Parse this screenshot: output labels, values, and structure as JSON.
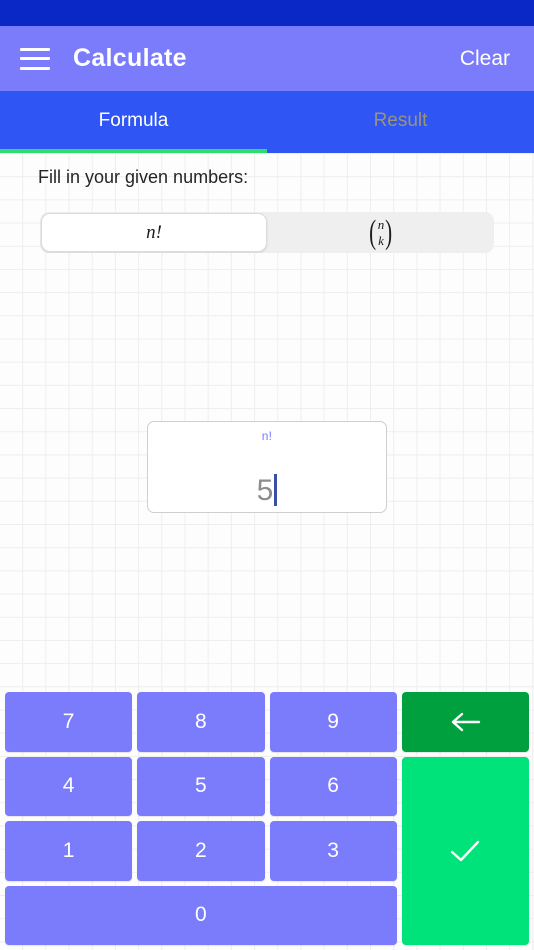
{
  "status_bar": {
    "color": "#0a28c6"
  },
  "app_bar": {
    "menu_icon": "hamburger-menu-icon",
    "title": "Calculate",
    "action_label": "Clear",
    "background": "#7b7cfb"
  },
  "tabs": {
    "background": "#2f55f4",
    "indicator_color": "#2ede6c",
    "active_index": 0,
    "items": [
      {
        "label": "Formula",
        "active": true
      },
      {
        "label": "Result",
        "active": false
      }
    ]
  },
  "main": {
    "prompt": "Fill in your given numbers:",
    "formula_selector": {
      "options": [
        {
          "id": "factorial",
          "label": "n!",
          "selected": true
        },
        {
          "id": "binomial",
          "top": "n",
          "bottom": "k",
          "selected": false
        }
      ]
    },
    "input_card": {
      "label": "n!",
      "value": "5",
      "caret_visible": true,
      "label_color": "#7b7cfb",
      "value_color": "#8d8d8d"
    }
  },
  "keypad": {
    "key_color": "#7b7cfb",
    "backspace_color": "#00a03e",
    "confirm_color": "#00e27a",
    "rows": [
      [
        "7",
        "8",
        "9"
      ],
      [
        "4",
        "5",
        "6"
      ],
      [
        "1",
        "2",
        "3"
      ],
      [
        "0"
      ]
    ],
    "backspace_icon": "arrow-left-icon",
    "confirm_icon": "check-icon"
  }
}
